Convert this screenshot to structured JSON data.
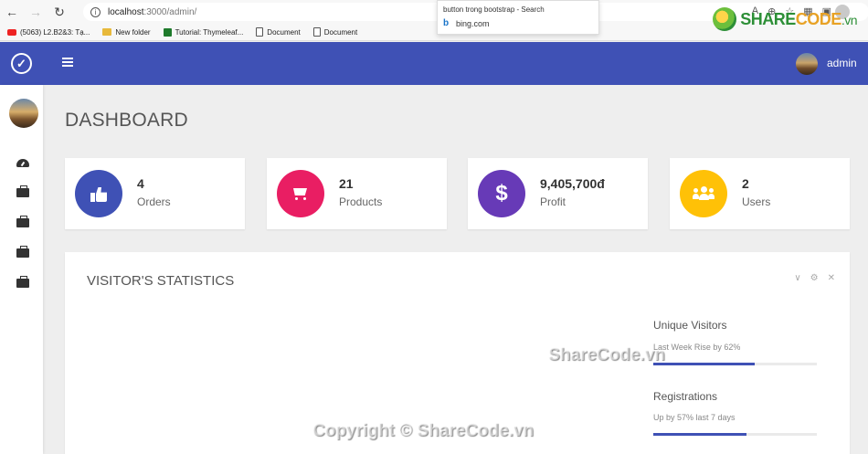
{
  "browser": {
    "url_host": "localhost",
    "url_path": ":3000/admin/",
    "suggestion": {
      "title": "button trong bootstrap - Search",
      "url": "bing.com"
    },
    "bookmarks": [
      {
        "label": "(5063) L2.B2&3: Tạ...",
        "icon": "youtube-icon"
      },
      {
        "label": "New folder",
        "icon": "folder-icon"
      },
      {
        "label": "Tutorial: Thymeleaf...",
        "icon": "thymeleaf-icon"
      },
      {
        "label": "Document",
        "icon": "document-icon"
      },
      {
        "label": "Document",
        "icon": "document-icon"
      }
    ]
  },
  "logo": {
    "text_main": "SHARE",
    "text_accent": "CODE",
    "text_suffix": ".vn"
  },
  "header": {
    "user": "admin"
  },
  "page": {
    "title": "DASHBOARD"
  },
  "stats": [
    {
      "value": "4",
      "label": "Orders",
      "color": "#3f51b5",
      "icon": "thumbs-up-icon"
    },
    {
      "value": "21",
      "label": "Products",
      "color": "#e91e63",
      "icon": "cart-icon"
    },
    {
      "value": "9,405,700đ",
      "label": "Profit",
      "color": "#673ab7",
      "icon": "dollar-icon"
    },
    {
      "value": "2",
      "label": "Users",
      "color": "#ffc107",
      "icon": "users-icon"
    }
  ],
  "panel": {
    "title": "VISITOR'S STATISTICS",
    "metrics": [
      {
        "title": "Unique Visitors",
        "sub": "Last Week Rise by 62%",
        "progress": 0.62
      },
      {
        "title": "Registrations",
        "sub": "Up by 57% last 7 days",
        "progress": 0.57
      }
    ]
  },
  "watermark": {
    "center": "ShareCode.vn",
    "bottom": "Copyright © ShareCode.vn"
  }
}
